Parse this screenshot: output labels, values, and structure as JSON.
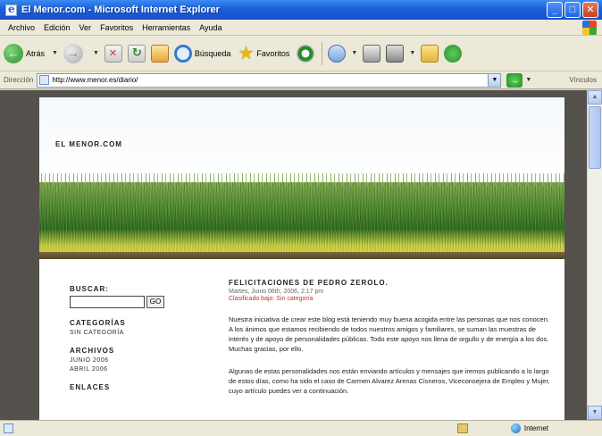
{
  "window": {
    "title": "El Menor.com - Microsoft Internet Explorer",
    "min_label": "_",
    "max_label": "□",
    "close_label": "✕"
  },
  "menu": [
    "Archivo",
    "Edición",
    "Ver",
    "Favoritos",
    "Herramientas",
    "Ayuda"
  ],
  "toolbar": {
    "back_label": "Atrás",
    "search_label": "Búsqueda",
    "favorites_label": "Favoritos"
  },
  "address": {
    "label": "Dirección",
    "url": "http://www.menor.es/diario/",
    "links_label": "Vínculos"
  },
  "site": {
    "title": "EL MENOR.COM"
  },
  "sidebar": {
    "search_heading": "BUSCAR:",
    "search_button": "GO",
    "categories_heading": "CATEGORÍAS",
    "categories": [
      "SIN CATEGORÍA"
    ],
    "archives_heading": "ARCHIVOS",
    "archives": [
      "JUNIO 2006",
      "ABRIL 2006"
    ],
    "links_heading": "ENLACES"
  },
  "post": {
    "title": "FELICITACIONES DE PEDRO ZEROLO.",
    "meta": "Martes, Junio 06th, 2006, 2:17 pm",
    "category": "Clasificado bajo: Sin categoría",
    "paragraphs": [
      "Nuestra iniciativa de crear este blog está teniendo muy buena acogida entre las personas que nos conocen. A los ánimos que estamos recibiendo de todos nuestros amigos y familiares, se suman las muestras de interés y de apoyo de personalidades públicas. Todo este apoyo nos llena de orgullo y de energía a los dos. Muchas gracias, por ello.",
      "Algunas de estas personalidades nos están enviando artículos y mensajes que iremos publicando a lo largo de estos días, como ha sido el caso de Carmen Alvarez Arenas Cisneros, Viceconsejera de Empleo y Mujer, cuyo artículo puedes ver a continuación."
    ]
  },
  "status": {
    "zone": "Internet"
  }
}
